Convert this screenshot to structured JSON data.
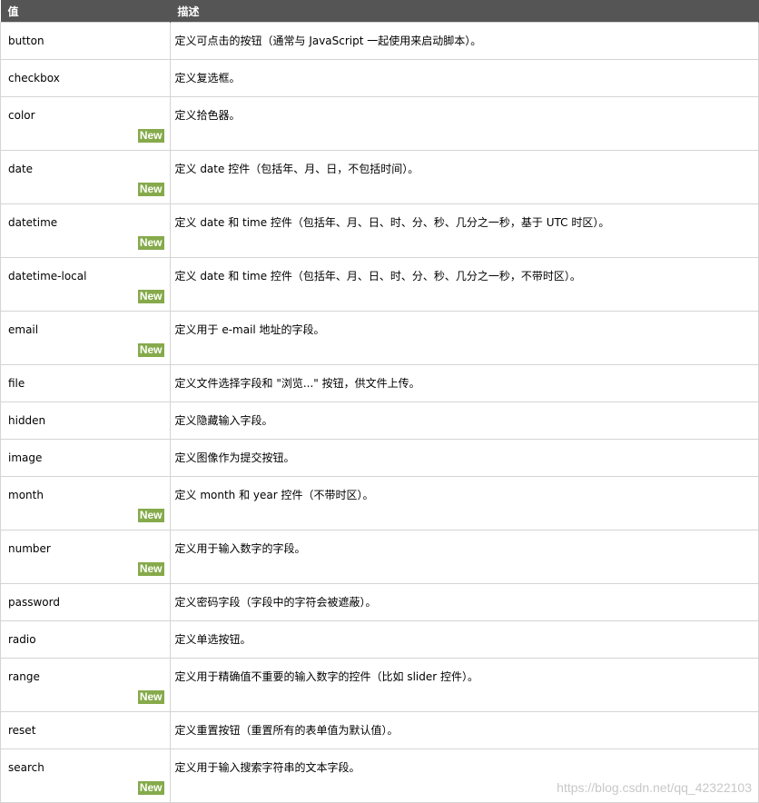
{
  "header": {
    "col_value": "值",
    "col_desc": "描述"
  },
  "new_label": "New",
  "rows": [
    {
      "value": "button",
      "desc": "定义可点击的按钮（通常与 JavaScript 一起使用来启动脚本）。",
      "is_new": false
    },
    {
      "value": "checkbox",
      "desc": "定义复选框。",
      "is_new": false
    },
    {
      "value": "color",
      "desc": "定义拾色器。",
      "is_new": true
    },
    {
      "value": "date",
      "desc": "定义 date 控件（包括年、月、日，不包括时间）。",
      "is_new": true
    },
    {
      "value": "datetime",
      "desc": "定义 date 和 time 控件（包括年、月、日、时、分、秒、几分之一秒，基于 UTC 时区）。",
      "is_new": true
    },
    {
      "value": "datetime-local",
      "desc": "定义 date 和 time 控件（包括年、月、日、时、分、秒、几分之一秒，不带时区）。",
      "is_new": true
    },
    {
      "value": "email",
      "desc": "定义用于 e-mail 地址的字段。",
      "is_new": true
    },
    {
      "value": "file",
      "desc": "定义文件选择字段和 \"浏览...\" 按钮，供文件上传。",
      "is_new": false
    },
    {
      "value": "hidden",
      "desc": "定义隐藏输入字段。",
      "is_new": false
    },
    {
      "value": "image",
      "desc": "定义图像作为提交按钮。",
      "is_new": false
    },
    {
      "value": "month",
      "desc": "定义 month 和 year 控件（不带时区）。",
      "is_new": true
    },
    {
      "value": "number",
      "desc": "定义用于输入数字的字段。",
      "is_new": true
    },
    {
      "value": "password",
      "desc": "定义密码字段（字段中的字符会被遮蔽）。",
      "is_new": false
    },
    {
      "value": "radio",
      "desc": "定义单选按钮。",
      "is_new": false
    },
    {
      "value": "range",
      "desc": "定义用于精确值不重要的输入数字的控件（比如 slider 控件）。",
      "is_new": true
    },
    {
      "value": "reset",
      "desc": "定义重置按钮（重置所有的表单值为默认值）。",
      "is_new": false
    },
    {
      "value": "search",
      "desc": "定义用于输入搜索字符串的文本字段。",
      "is_new": true
    }
  ],
  "watermark": "https://blog.csdn.net/qq_42322103"
}
